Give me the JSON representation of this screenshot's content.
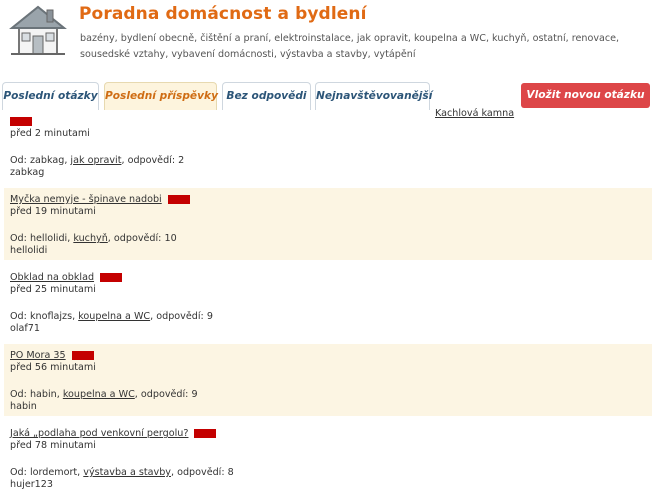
{
  "site": {
    "title": "Poradna domácnost a bydlení",
    "categories": "bazény, bydlení obecně, čištění a praní, elektroinstalace, jak opravit, koupelna a WC, kuchyň, ostatní, renovace, sousedské vztahy, vybavení domácnosti, výstavba a stavby, vytápění"
  },
  "tabs": [
    {
      "label": "Poslední otázky",
      "active": false
    },
    {
      "label": "Poslední příspěvky",
      "active": true
    },
    {
      "label": "Bez odpovědi",
      "active": false
    },
    {
      "label": "Nejnavštěvovanější",
      "active": false
    }
  ],
  "ask_button": "Vložit novou otázku",
  "side_link": "Kachlová kamna",
  "colors": {
    "accent": "#e06a14",
    "button": "#dd4648",
    "flag": "#c40000",
    "alt_row": "#fcf5e3"
  },
  "posts": [
    {
      "title": "",
      "time": "před 2 minutami",
      "from_label": "Od:",
      "author": "zabkag",
      "category": "jak opravit",
      "replies_label": "odpovědí:",
      "replies": "2",
      "last_user": "zabkag"
    },
    {
      "title": "Myčka nemyje - špinave nadobi",
      "time": "před 19 minutami",
      "from_label": "Od:",
      "author": "hellolidi",
      "category": "kuchyň",
      "replies_label": "odpovědí:",
      "replies": "10",
      "last_user": "hellolidi"
    },
    {
      "title": "Obklad na obklad",
      "time": "před 25 minutami",
      "from_label": "Od:",
      "author": "knoflajzs",
      "category": "koupelna a WC",
      "replies_label": "odpovědí:",
      "replies": "9",
      "last_user": "olaf71"
    },
    {
      "title": "PO Mora 35",
      "time": "před 56 minutami",
      "from_label": "Od:",
      "author": "habin",
      "category": "koupelna a WC",
      "replies_label": "odpovědí:",
      "replies": "9",
      "last_user": "habin"
    },
    {
      "title": "Jaká „podlaha pod venkovní pergolu?",
      "time": "před 78 minutami",
      "from_label": "Od:",
      "author": "lordemort",
      "category": "výstavba a stavby",
      "replies_label": "odpovědí:",
      "replies": "8",
      "last_user": "hujer123"
    }
  ]
}
